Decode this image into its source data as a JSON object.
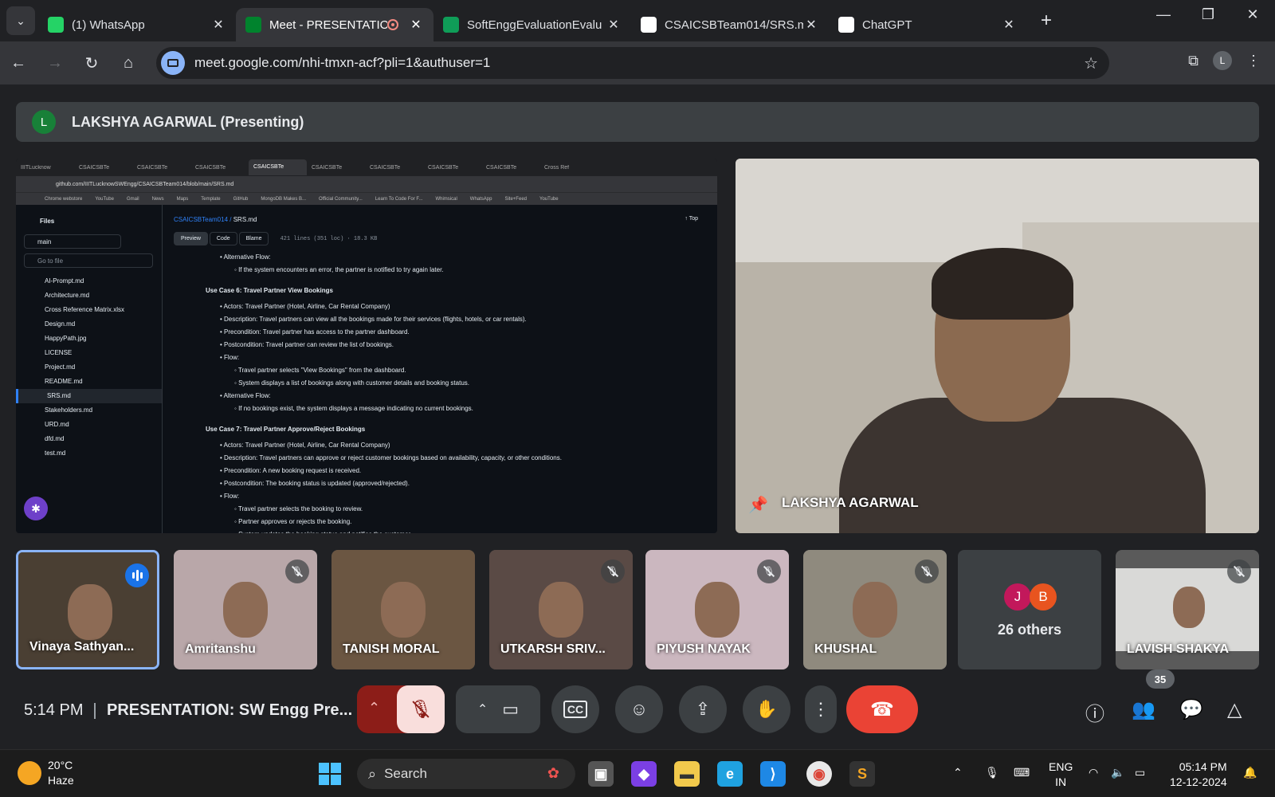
{
  "browser": {
    "tabs": [
      {
        "title": "(1) WhatsApp",
        "icon": "whatsapp-icon",
        "color": "#25d366",
        "active": false
      },
      {
        "title": "Meet - PRESENTATIO",
        "icon": "meet-icon",
        "color": "#00832d",
        "active": true,
        "recording": true
      },
      {
        "title": "SoftEnggEvaluationEvalu",
        "icon": "sheets-icon",
        "color": "#0f9d58",
        "active": false
      },
      {
        "title": "CSAICSBTeam014/SRS.m",
        "icon": "github-icon",
        "color": "#ffffff",
        "active": false
      },
      {
        "title": "ChatGPT",
        "icon": "chatgpt-icon",
        "color": "#ffffff",
        "active": false
      }
    ],
    "url": "meet.google.com/nhi-tmxn-acf?pli=1&authuser=1",
    "profile_initial": "L"
  },
  "presenting_banner": {
    "avatar": "L",
    "text": "LAKSHYA AGARWAL (Presenting)"
  },
  "shared_screen": {
    "tabs": [
      "IIITLucknow",
      "CSAICSBTe",
      "CSAICSBTe",
      "CSAICSBTe",
      "CSAICSBTe",
      "CSAICSBTe",
      "CSAICSBTe",
      "CSAICSBTe",
      "CSAICSBTe",
      "Cross Ref"
    ],
    "url": "github.com/IIITLucknowSWEngg/CSAICSBTeam014/blob/main/SRS.md",
    "bookmarks": [
      "Chrome webstore",
      "YouTube",
      "Gmail",
      "News",
      "Maps",
      "Template",
      "GitHub",
      "MongoDB Makes B...",
      "Official Community...",
      "Learn To Code For F...",
      "Whimsical",
      "WhatsApp",
      "Site+Feed",
      "YouTube"
    ],
    "files_heading": "Files",
    "branch": "main",
    "goto_placeholder": "Go to file",
    "files": [
      "AI-Prompt.md",
      "Architecture.md",
      "Cross Reference Matrix.xlsx",
      "Design.md",
      "HappyPath.jpg",
      "LICENSE",
      "Project.md",
      "README.md",
      "SRS.md",
      "Stakeholders.md",
      "URD.md",
      "dfd.md",
      "test.md"
    ],
    "selected_file": "SRS.md",
    "breadcrumb_repo": "CSAICSBTeam014",
    "breadcrumb_file": "SRS.md",
    "top_label": "↑ Top",
    "view_tabs": [
      "Preview",
      "Code",
      "Blame"
    ],
    "file_meta": "421 lines (351 loc) · 18.3 KB",
    "doc_lines": [
      {
        "cls": "b1",
        "text": "Alternative Flow:"
      },
      {
        "cls": "b2",
        "text": "If the system encounters an error, the partner is notified to try again later."
      },
      {
        "cls": "h",
        "text": "Use Case 6: Travel Partner View Bookings"
      },
      {
        "cls": "b1",
        "text": "Actors: Travel Partner (Hotel, Airline, Car Rental Company)"
      },
      {
        "cls": "b1",
        "text": "Description: Travel partners can view all the bookings made for their services (flights, hotels, or car rentals)."
      },
      {
        "cls": "b1",
        "text": "Precondition: Travel partner has access to the partner dashboard."
      },
      {
        "cls": "b1",
        "text": "Postcondition: Travel partner can review the list of bookings."
      },
      {
        "cls": "b1",
        "text": "Flow:"
      },
      {
        "cls": "b2",
        "text": "Travel partner selects \"View Bookings\" from the dashboard."
      },
      {
        "cls": "b2",
        "text": "System displays a list of bookings along with customer details and booking status."
      },
      {
        "cls": "b1",
        "text": "Alternative Flow:"
      },
      {
        "cls": "b2",
        "text": "If no bookings exist, the system displays a message indicating no current bookings."
      },
      {
        "cls": "h",
        "text": "Use Case 7: Travel Partner Approve/Reject Bookings"
      },
      {
        "cls": "b1",
        "text": "Actors: Travel Partner (Hotel, Airline, Car Rental Company)"
      },
      {
        "cls": "b1",
        "text": "Description: Travel partners can approve or reject customer bookings based on availability, capacity, or other conditions."
      },
      {
        "cls": "b1",
        "text": "Precondition: A new booking request is received."
      },
      {
        "cls": "b1",
        "text": "Postcondition: The booking status is updated (approved/rejected)."
      },
      {
        "cls": "b1",
        "text": "Flow:"
      },
      {
        "cls": "b2",
        "text": "Travel partner selects the booking to review."
      },
      {
        "cls": "b2",
        "text": "Partner approves or rejects the booking."
      },
      {
        "cls": "b2",
        "text": "System updates the booking status and notifies the customer."
      }
    ]
  },
  "pinned_participant": {
    "name": "LAKSHYA AGARWAL"
  },
  "participants": [
    {
      "name": "Vinaya Sathyan...",
      "speaking": true,
      "muted": false,
      "bg": "#4a3f33"
    },
    {
      "name": "Amritanshu",
      "speaking": false,
      "muted": true,
      "bg": "#b9a7a9"
    },
    {
      "name": "TANISH MORAL",
      "speaking": false,
      "muted": false,
      "bg": "#6b5642"
    },
    {
      "name": "UTKARSH SRIV...",
      "speaking": false,
      "muted": true,
      "bg": "#5a4a45"
    },
    {
      "name": "PIYUSH NAYAK",
      "speaking": false,
      "muted": true,
      "bg": "#cbb7bf"
    },
    {
      "name": "KHUSHAL",
      "speaking": false,
      "muted": true,
      "bg": "#8f8a7e"
    }
  ],
  "others": {
    "avatars": [
      {
        "letter": "J",
        "color": "#c2185b"
      },
      {
        "letter": "B",
        "color": "#e8541f"
      }
    ],
    "label": "26 others"
  },
  "last_participant": {
    "name": "LAVISH SHAKYA",
    "muted": true
  },
  "meeting": {
    "time": "5:14 PM",
    "title": "PRESENTATION: SW Engg Pre...",
    "people_count": "35"
  },
  "taskbar": {
    "temperature": "20°C",
    "condition": "Haze",
    "search": "Search",
    "lang_top": "ENG",
    "lang_bottom": "IN",
    "time": "05:14 PM",
    "date": "12-12-2024"
  }
}
